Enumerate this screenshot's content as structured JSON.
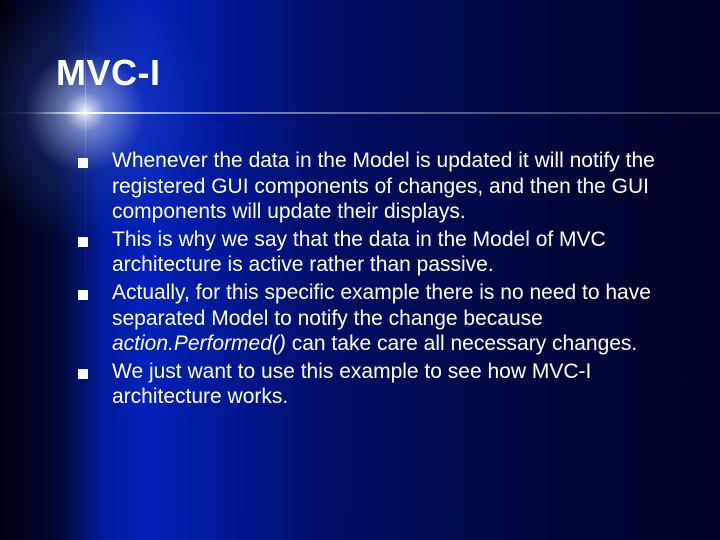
{
  "title": "MVC-I",
  "bullets": [
    {
      "text": "Whenever the data in the Model is updated it will notify the registered GUI components of changes, and then the GUI components will update their displays."
    },
    {
      "text": "This is why we say that the data in the Model of MVC architecture is active rather than passive."
    },
    {
      "text_pre": "Actually, for this specific example there is no need to have separated Model to notify the change because ",
      "em": "action.Performed()",
      "text_post": " can take care all necessary changes."
    },
    {
      "text": "We just want to use this example to see how MVC-I architecture works."
    }
  ]
}
